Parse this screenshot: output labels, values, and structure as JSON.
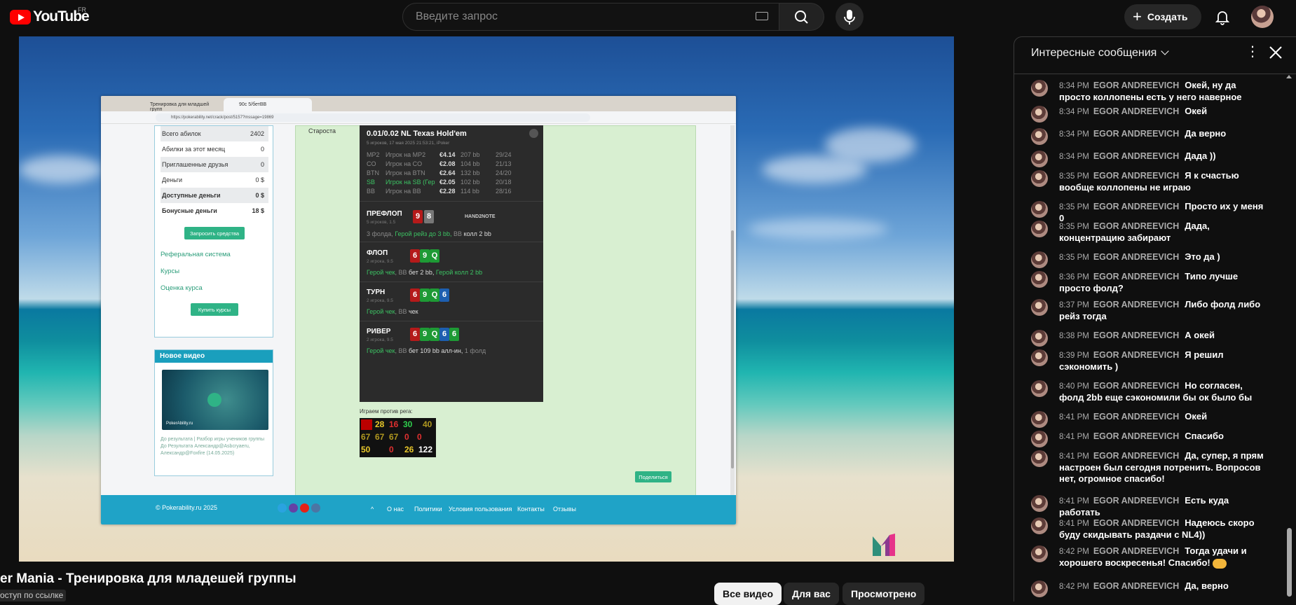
{
  "header": {
    "brand": "YouTube",
    "country": "FR",
    "search_placeholder": "Введите запрос",
    "create_label": "Создать"
  },
  "video": {
    "title": "er Mania - Тренировка для младешей группы",
    "access": "оступ по ссылке",
    "chips": [
      "Все видео",
      "Для вас",
      "Просмотрено"
    ],
    "browser": {
      "tab1": "Тренировка для младшей групп",
      "tab2": "90с 5/бетBB",
      "url": "https://pokerability.net/crack/post/5157?mssage=19869"
    },
    "left_panel": {
      "rows": [
        [
          "Всего абилок",
          "2402"
        ],
        [
          "Абилки за этот месяц",
          "0"
        ],
        [
          "Приглашенные друзья",
          "0"
        ],
        [
          "Деньги",
          "0 $"
        ],
        [
          "Доступные деньги",
          "0 $"
        ],
        [
          "Бонусные деньги",
          "18 $"
        ]
      ],
      "request_btn": "Запросить средства",
      "ref": "Реферальная система",
      "courses": "Курсы",
      "course_rating": "Оценка курса",
      "buy_btn": "Купить курсы"
    },
    "new_video": {
      "heading": "Новое видео",
      "caption": "До результата | Разбор игры учеников группы До Результата Александр@Asbcryaeru, Александр@Foxfire (14.05.2025)",
      "thumb_label": "PokerAbility.ru"
    },
    "starosta": "Староста",
    "hand": {
      "title": "0.01/0.02 NL Texas Hold'em",
      "sub": "5 игроков, 17 мая 2025 21:53:21, iPoker",
      "players": [
        {
          "pos": "MP2",
          "name": "Игрок на MP2",
          "amt": "€4.14",
          "bb": "207 bb",
          "st": "29/24"
        },
        {
          "pos": "CO",
          "name": "Игрок на CO",
          "amt": "€2.08",
          "bb": "104 bb",
          "st": "21/13"
        },
        {
          "pos": "BTN",
          "name": "Игрок на BTN",
          "amt": "€2.64",
          "bb": "132 bb",
          "st": "24/20"
        },
        {
          "pos": "SB",
          "name": "Игрок на SB (Гер",
          "amt": "€2.05",
          "bb": "102 bb",
          "st": "20/18"
        },
        {
          "pos": "BB",
          "name": "Игрок на BB",
          "amt": "€2.28",
          "bb": "114 bb",
          "st": "28/16"
        }
      ],
      "preflop": {
        "name": "ПРЕФЛОП",
        "sub": "5 игроков, 1.5",
        "a1": "3 фолда,",
        "a2": "Герой рейз до 3 bb,",
        "a3": "BB",
        "a4": "колл 2 bb",
        "brand": "HAND2NOTE"
      },
      "flop": {
        "name": "ФЛОП",
        "sub": "2 игрока, 9.5",
        "a1": "Герой чек",
        "a2": ", BB",
        "a3": "бет 2 bb,",
        "a4": "Герой колл 2 bb"
      },
      "turn": {
        "name": "ТУРН",
        "sub": "2 игрока, 9.5",
        "a1": "Герой чек",
        "a2": ", BB",
        "a3": "чек"
      },
      "river": {
        "name": "РИВЕР",
        "sub": "2 игрока, 9.5",
        "a1": "Герой чек",
        "a2": ", BB",
        "a3": "бет 109 bb алл-ин,",
        "a4": "1 фолд"
      },
      "cards": {
        "pre": [
          "9",
          "8"
        ],
        "flop": [
          "6",
          "9",
          "Q"
        ],
        "turn": [
          "6",
          "9",
          "Q",
          "6"
        ],
        "river": [
          "6",
          "9",
          "Q",
          "6",
          "6"
        ]
      }
    },
    "play_vs": "Играем против рега:",
    "stats": [
      "28",
      "16",
      "30",
      "40",
      "67",
      "67",
      "67",
      "0",
      "0",
      "50",
      "0",
      "26",
      "122"
    ],
    "share_btn": "Поделиться",
    "footer": {
      "copyright": "© Pokerability.ru 2025",
      "links": [
        "О нас",
        "Политики",
        "Условия пользования",
        "Контакты",
        "Отзывы"
      ]
    }
  },
  "chat": {
    "heading": "Интересные сообщения",
    "author": "EGOR ANDREEVICH",
    "messages": [
      {
        "t": "8:34 PM",
        "x": "Окей, ну да просто коллопены есть у него наверное"
      },
      {
        "t": "8:34 PM",
        "x": "Окей"
      },
      {
        "t": "8:34 PM",
        "x": "Да верно"
      },
      {
        "t": "8:34 PM",
        "x": "Дада ))"
      },
      {
        "t": "8:35 PM",
        "x": "Я к счастью вообще коллопены не играю"
      },
      {
        "t": "8:35 PM",
        "x": "Просто их у меня 0"
      },
      {
        "t": "8:35 PM",
        "x": "Дада, концентрацию забирают"
      },
      {
        "t": "8:35 PM",
        "x": "Это да )"
      },
      {
        "t": "8:36 PM",
        "x": "Типо лучше просто фолд?"
      },
      {
        "t": "8:37 PM",
        "x": "Либо фолд либо рейз тогда"
      },
      {
        "t": "8:38 PM",
        "x": "А окей"
      },
      {
        "t": "8:39 PM",
        "x": "Я решил сэкономить )"
      },
      {
        "t": "8:40 PM",
        "x": "Но согласен, фолд 2bb еще сэкономили бы ок было бы"
      },
      {
        "t": "8:41 PM",
        "x": "Окей"
      },
      {
        "t": "8:41 PM",
        "x": "Спасибо"
      },
      {
        "t": "8:41 PM",
        "x": "Да, супер, я прям настроен был сегодня потренить. Вопросов нет, огромное спасибо!"
      },
      {
        "t": "8:41 PM",
        "x": "Есть куда работать"
      },
      {
        "t": "8:41 PM",
        "x": "Надеюсь скоро буду скидывать раздачи с NL4))"
      },
      {
        "t": "8:42 PM",
        "x": "Тогда удачи и хорошего воскресенья! Спасибо!"
      },
      {
        "t": "8:42 PM",
        "x": "Да, верно"
      }
    ]
  }
}
